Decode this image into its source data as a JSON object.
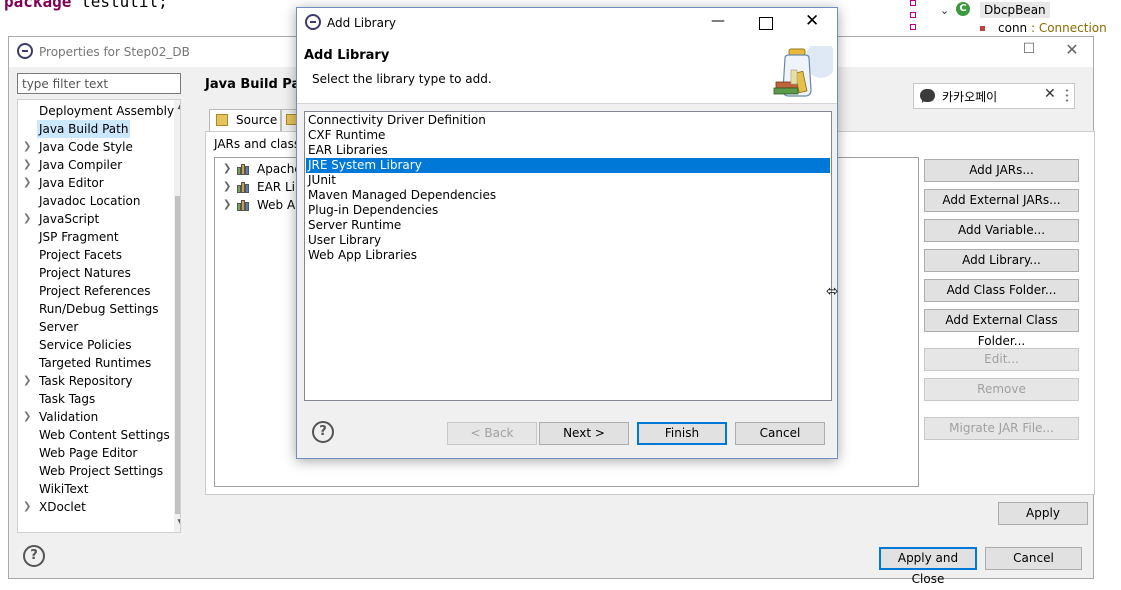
{
  "editor": {
    "code_keyword": "package",
    "code_rest": " testutil;"
  },
  "outline": {
    "class_name": "DbcpBean",
    "field_name": "conn",
    "field_type": " : Connection",
    "class_icon_letter": "C"
  },
  "properties": {
    "title": "Properties for Step02_DB",
    "filter_placeholder": "type filter text",
    "tree_items": [
      {
        "label": "Deployment Assembly",
        "expandable": false
      },
      {
        "label": "Java Build Path",
        "expandable": false,
        "selected": true
      },
      {
        "label": "Java Code Style",
        "expandable": true
      },
      {
        "label": "Java Compiler",
        "expandable": true
      },
      {
        "label": "Java Editor",
        "expandable": true
      },
      {
        "label": "Javadoc Location",
        "expandable": false
      },
      {
        "label": "JavaScript",
        "expandable": true
      },
      {
        "label": "JSP Fragment",
        "expandable": false
      },
      {
        "label": "Project Facets",
        "expandable": false
      },
      {
        "label": "Project Natures",
        "expandable": false
      },
      {
        "label": "Project References",
        "expandable": false
      },
      {
        "label": "Run/Debug Settings",
        "expandable": false
      },
      {
        "label": "Server",
        "expandable": false
      },
      {
        "label": "Service Policies",
        "expandable": false
      },
      {
        "label": "Targeted Runtimes",
        "expandable": false
      },
      {
        "label": "Task Repository",
        "expandable": true
      },
      {
        "label": "Task Tags",
        "expandable": false
      },
      {
        "label": "Validation",
        "expandable": true
      },
      {
        "label": "Web Content Settings",
        "expandable": false
      },
      {
        "label": "Web Page Editor",
        "expandable": false
      },
      {
        "label": "Web Project Settings",
        "expandable": false
      },
      {
        "label": "WikiText",
        "expandable": false
      },
      {
        "label": "XDoclet",
        "expandable": true
      }
    ],
    "page_title": "Java Build Path",
    "tab_source": "Source",
    "jars_label": "JARs and class f",
    "libraries": [
      "Apache",
      "EAR Lib",
      "Web Ap"
    ],
    "buttons": {
      "add_jars": "Add JARs...",
      "add_external_jars": "Add External JARs...",
      "add_variable": "Add Variable...",
      "add_library": "Add Library...",
      "add_class_folder": "Add Class Folder...",
      "add_external_class_folder": "Add External Class Folder...",
      "edit": "Edit...",
      "remove": "Remove",
      "migrate": "Migrate JAR File...",
      "apply": "Apply",
      "apply_and_close": "Apply and Close",
      "cancel": "Cancel"
    }
  },
  "kakao": {
    "label": "카카오페이"
  },
  "add_library": {
    "title": "Add Library",
    "heading": "Add Library",
    "description": "Select the library type to add.",
    "types": [
      "Connectivity Driver Definition",
      "CXF Runtime",
      "EAR Libraries",
      "JRE System Library",
      "JUnit",
      "Maven Managed Dependencies",
      "Plug-in Dependencies",
      "Server Runtime",
      "User Library",
      "Web App Libraries"
    ],
    "selected_type": "JRE System Library",
    "buttons": {
      "back": "< Back",
      "next": "Next >",
      "finish": "Finish",
      "cancel": "Cancel"
    }
  },
  "colors": {
    "selection": "#0078d7",
    "tree_selection": "#cce8ff",
    "dialog_bg": "#f0f0f0"
  }
}
